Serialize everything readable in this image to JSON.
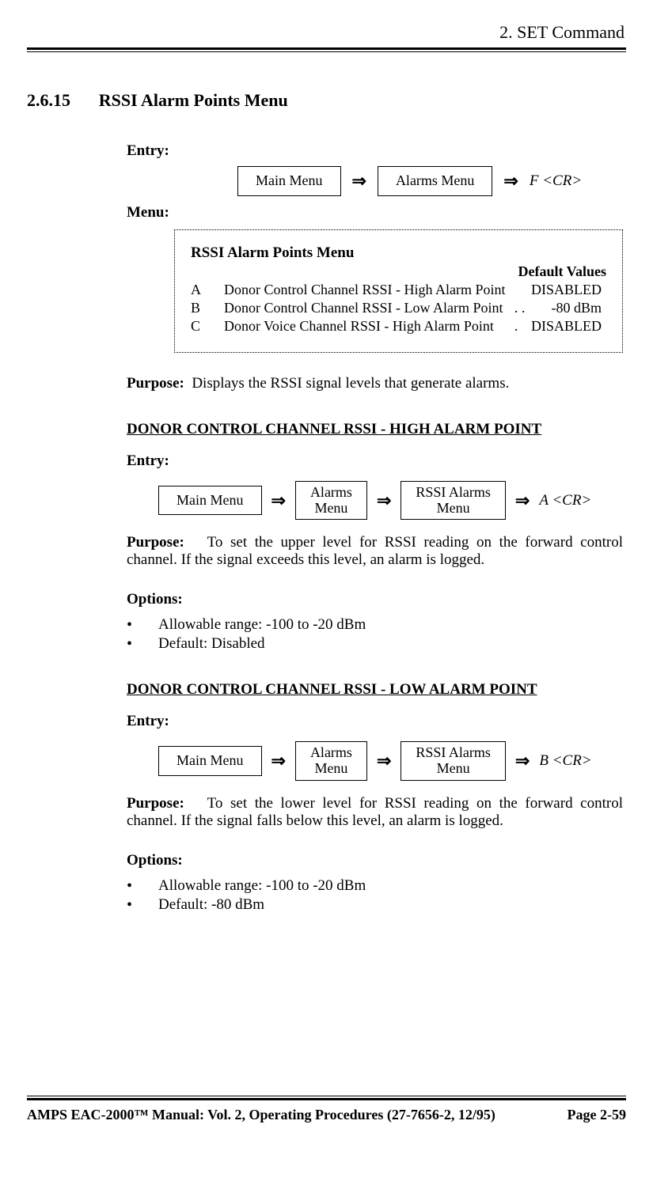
{
  "header": {
    "running": "2.  SET Command"
  },
  "section": {
    "num": "2.6.15",
    "title": "RSSI Alarm Points Menu"
  },
  "labels": {
    "entry": "Entry:",
    "menu": "Menu:",
    "purpose": "Purpose:",
    "options": "Options:"
  },
  "flow_top": {
    "b1": "Main Menu",
    "b2": "Alarms Menu",
    "last": "F <CR>"
  },
  "menu_box": {
    "title": "RSSI Alarm Points Menu",
    "default_head": "Default Values",
    "rows": [
      {
        "k": "A",
        "d": "Donor Control Channel RSSI - High Alarm Point",
        "dots": "",
        "v": "DISABLED"
      },
      {
        "k": "B",
        "d": "Donor Control Channel RSSI - Low Alarm Point",
        "dots": ". .",
        "v": "-80 dBm"
      },
      {
        "k": "C",
        "d": "Donor Voice Channel RSSI - High Alarm Point",
        "dots": ".",
        "v": "DISABLED"
      }
    ]
  },
  "purpose_top": "Displays the RSSI signal levels that generate alarms.",
  "sub1": {
    "heading": "DONOR CONTROL CHANNEL RSSI - HIGH ALARM POINT",
    "flow": {
      "b1": "Main Menu",
      "b2_l1": "Alarms",
      "b2_l2": "Menu",
      "b3_l1": "RSSI Alarms",
      "b3_l2": "Menu",
      "last": "A <CR>"
    },
    "purpose": "To set the upper level for RSSI reading on the forward control channel.  If the signal exceeds this level, an alarm is logged.",
    "opts": [
      "Allowable range:  -100 to -20 dBm",
      "Default:  Disabled"
    ]
  },
  "sub2": {
    "heading": "DONOR CONTROL CHANNEL RSSI - LOW ALARM POINT",
    "flow": {
      "b1": "Main Menu",
      "b2_l1": "Alarms",
      "b2_l2": "Menu",
      "b3_l1": "RSSI Alarms",
      "b3_l2": "Menu",
      "last": "B <CR>"
    },
    "purpose": "To set the lower level for RSSI reading on the forward control channel.  If the signal falls below this level, an alarm is logged.",
    "opts": [
      "Allowable range:  -100 to -20 dBm",
      "Default:  -80 dBm"
    ]
  },
  "footer": {
    "left": "AMPS EAC-2000™ Manual:  Vol. 2, Operating Procedures (27-7656-2, 12/95)",
    "right": "Page 2-59"
  }
}
